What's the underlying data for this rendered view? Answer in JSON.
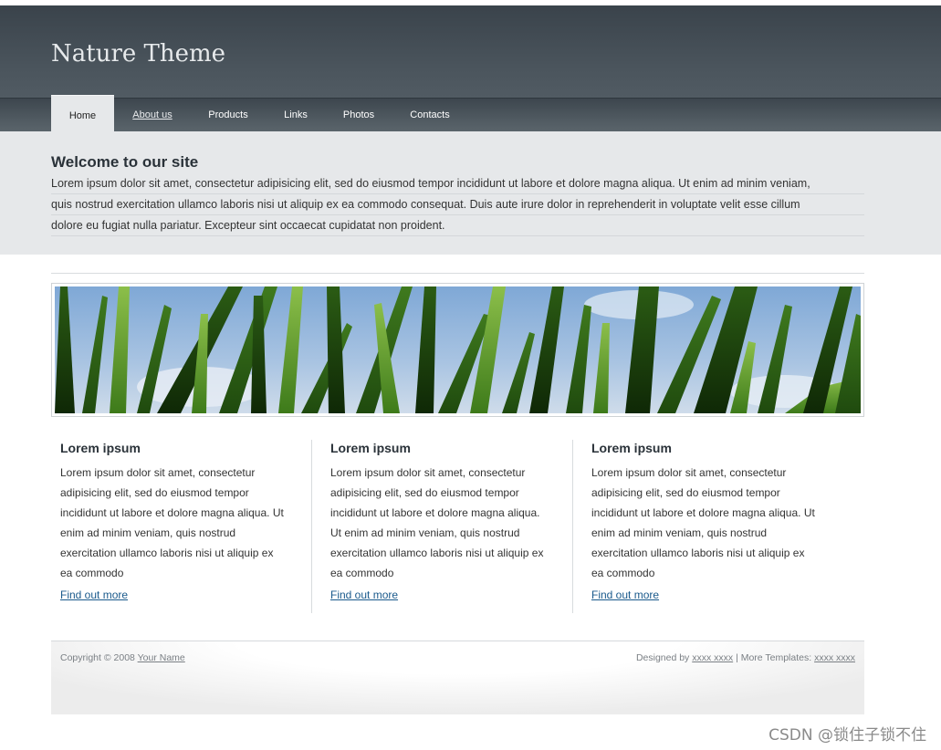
{
  "site": {
    "title": "Nature Theme"
  },
  "nav": {
    "items": [
      {
        "label": "Home",
        "active": true
      },
      {
        "label": "About us"
      },
      {
        "label": "Products"
      },
      {
        "label": "Links"
      },
      {
        "label": "Photos"
      },
      {
        "label": "Contacts"
      }
    ]
  },
  "welcome": {
    "heading": "Welcome to our site",
    "lines": [
      "Lorem ipsum dolor sit amet, consectetur adipisicing elit, sed do eiusmod tempor incididunt ut labore et dolore magna aliqua. Ut enim ad minim veniam,",
      "quis nostrud exercitation ullamco laboris nisi ut aliquip ex ea commodo consequat. Duis aute irure dolor in reprehenderit in voluptate velit esse cillum",
      "dolore eu fugiat nulla pariatur. Excepteur sint occaecat cupidatat non proident."
    ]
  },
  "columns": [
    {
      "heading": "Lorem ipsum",
      "lines": [
        "Lorem ipsum dolor sit amet, consectetur",
        "adipisicing elit, sed do eiusmod tempor",
        "incididunt ut labore et dolore magna aliqua. Ut",
        "enim ad minim veniam, quis nostrud",
        "exercitation ullamco laboris nisi ut aliquip ex",
        "ea commodo"
      ],
      "link": "Find out more"
    },
    {
      "heading": "Lorem ipsum",
      "lines": [
        "Lorem ipsum dolor sit amet, consectetur",
        "adipisicing elit, sed do eiusmod tempor",
        "incididunt ut labore et dolore magna aliqua.",
        "Ut enim ad minim veniam, quis nostrud",
        "exercitation ullamco laboris nisi ut aliquip ex",
        "ea commodo"
      ],
      "link": "Find out more"
    },
    {
      "heading": "Lorem ipsum",
      "lines": [
        "Lorem ipsum dolor sit amet, consectetur",
        "adipisicing elit, sed do eiusmod tempor",
        "incididunt ut labore et dolore magna aliqua. Ut",
        "enim ad minim veniam, quis nostrud",
        "exercitation ullamco laboris nisi ut aliquip ex",
        "ea commodo"
      ],
      "link": "Find out more"
    }
  ],
  "footer": {
    "copyright": "Copyright © 2008",
    "name_link": "Your Name",
    "designed_by": "Designed by",
    "designer_link": "xxxx xxxx",
    "more_templates": "| More Templates:",
    "templates_link": "xxxx xxxx"
  },
  "watermark": "CSDN @锁住子锁不住",
  "colors": {
    "header": "#414a52",
    "welcome_bg": "#e6e8ea",
    "link": "#1a5a8c"
  }
}
